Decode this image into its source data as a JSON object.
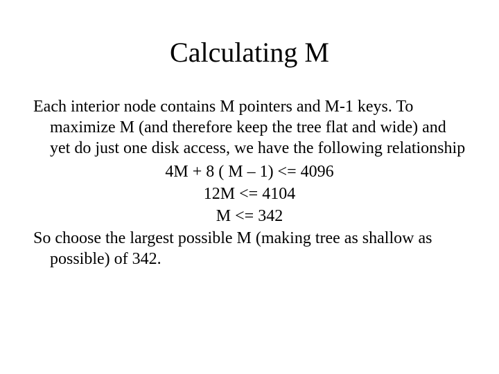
{
  "title": "Calculating M",
  "para1": "Each interior node contains M pointers and M-1 keys. To maximize M (and therefore keep the tree flat and wide) and yet do just one disk access, we have the following relationship",
  "eq1": "4M + 8 ( M – 1) <= 4096",
  "eq2": "12M <= 4104",
  "eq3": "M <= 342",
  "para2": "So choose the largest possible M (making tree as shallow as possible) of 342."
}
